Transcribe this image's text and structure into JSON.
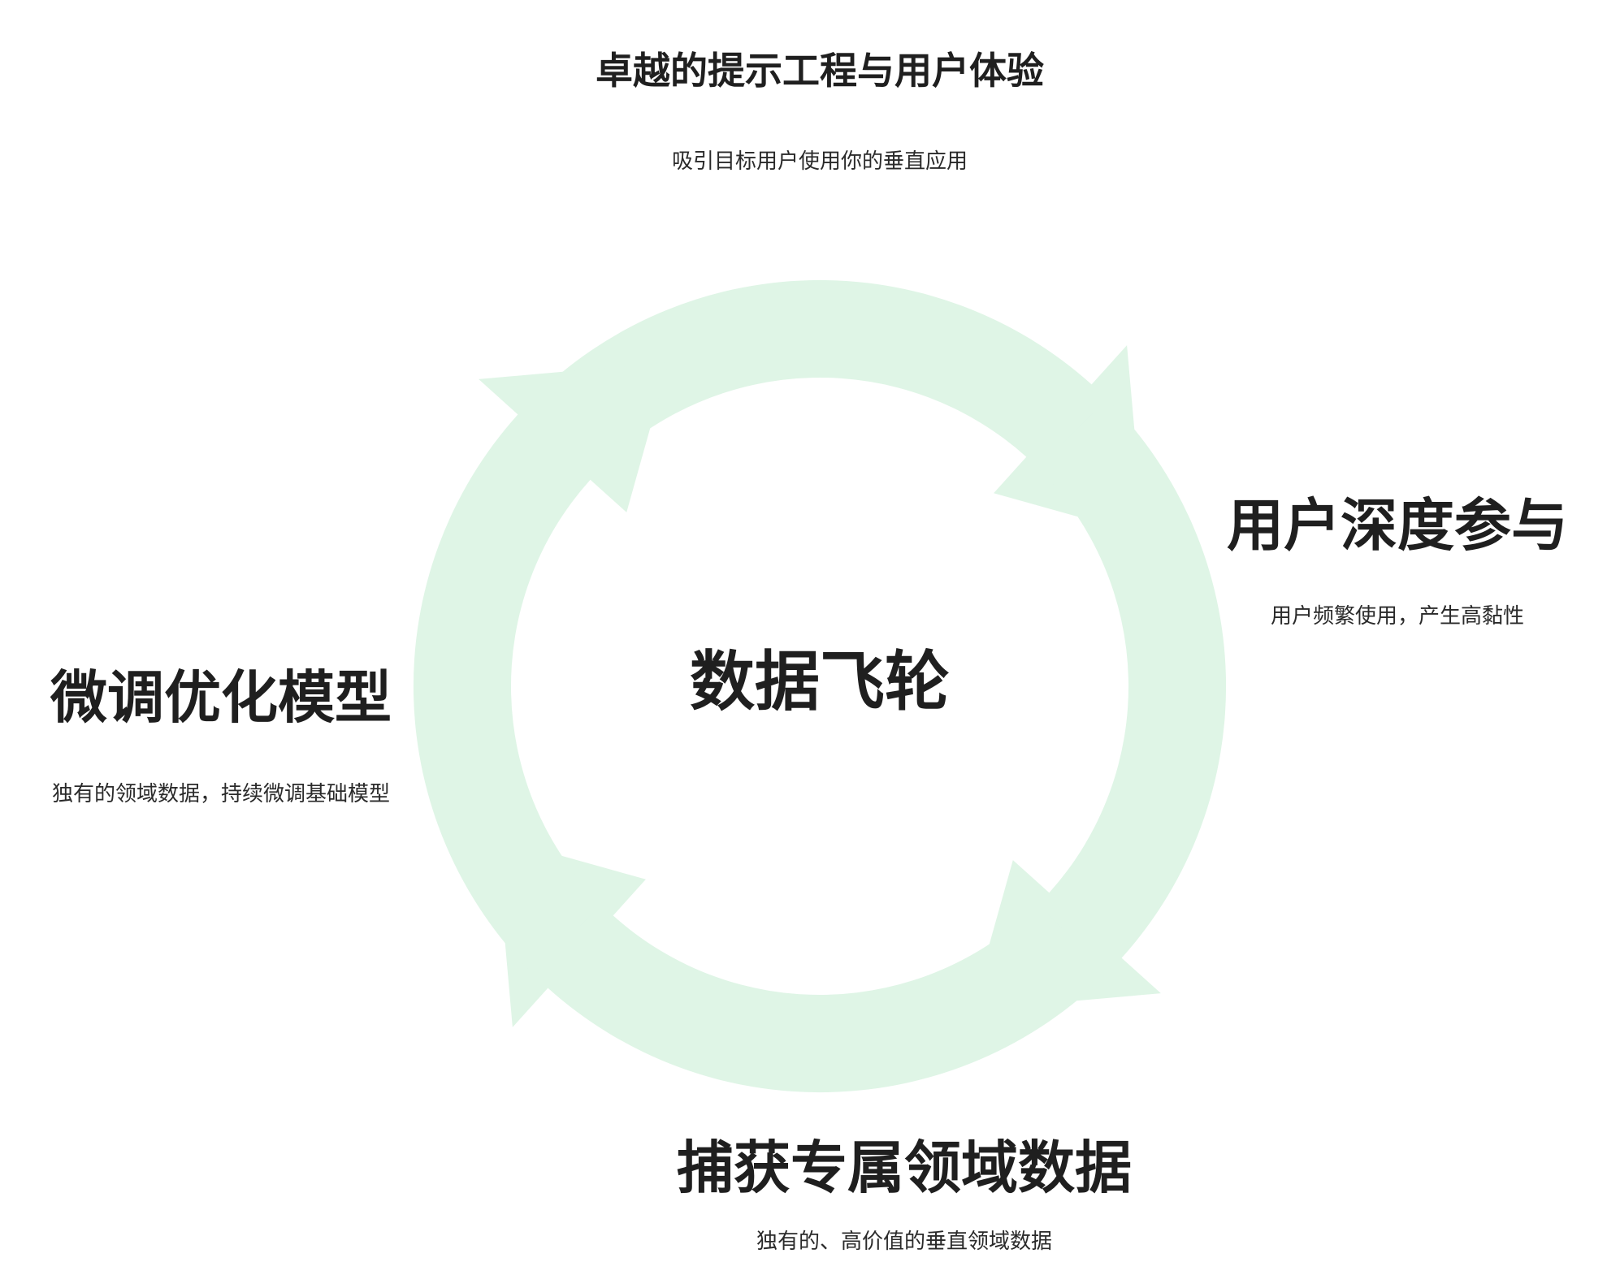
{
  "diagram": {
    "center_label": "数据飞轮",
    "arrow_color": "#dff5e6",
    "text_color": "#1f1f1f",
    "nodes": [
      {
        "title": "卓越的提示工程与用户体验",
        "description": "吸引目标用户使用你的垂直应用"
      },
      {
        "title": "用户深度参与",
        "description": "用户频繁使用，产生高黏性"
      },
      {
        "title": "捕获专属领域数据",
        "description": "独有的、高价值的垂直领域数据"
      },
      {
        "title": "微调优化模型",
        "description": "独有的领域数据，持续微调基础模型"
      }
    ]
  }
}
